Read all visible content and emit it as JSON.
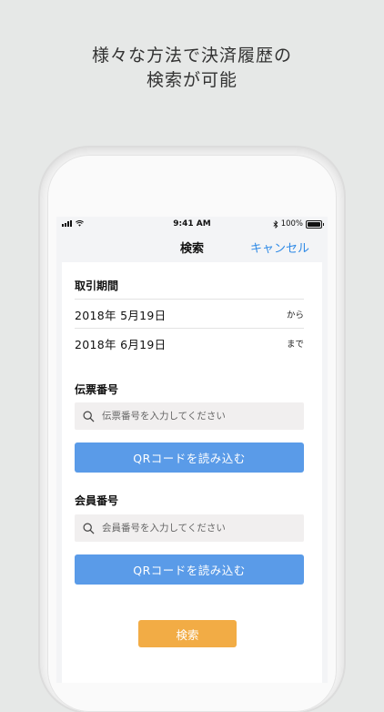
{
  "headline": {
    "line1": "様々な方法で決済履歴の",
    "line2": "検索が可能"
  },
  "status_bar": {
    "time": "9:41 AM",
    "battery": "100%"
  },
  "nav": {
    "title": "検索",
    "cancel": "キャンセル"
  },
  "period": {
    "label": "取引期間",
    "from_date": "2018年 5月19日",
    "from_suffix": "から",
    "to_date": "2018年 6月19日",
    "to_suffix": "まで"
  },
  "slip": {
    "label": "伝票番号",
    "placeholder": "伝票番号を入力してください",
    "qr_button": "QRコードを読み込む"
  },
  "member": {
    "label": "会員番号",
    "placeholder": "会員番号を入力してください",
    "qr_button": "QRコードを読み込む"
  },
  "search_button": "検索",
  "colors": {
    "accent_blue": "#2f8ae6",
    "qr_button": "#5a9be8",
    "search_button": "#f2ac45",
    "background": "#e6e8e7"
  }
}
